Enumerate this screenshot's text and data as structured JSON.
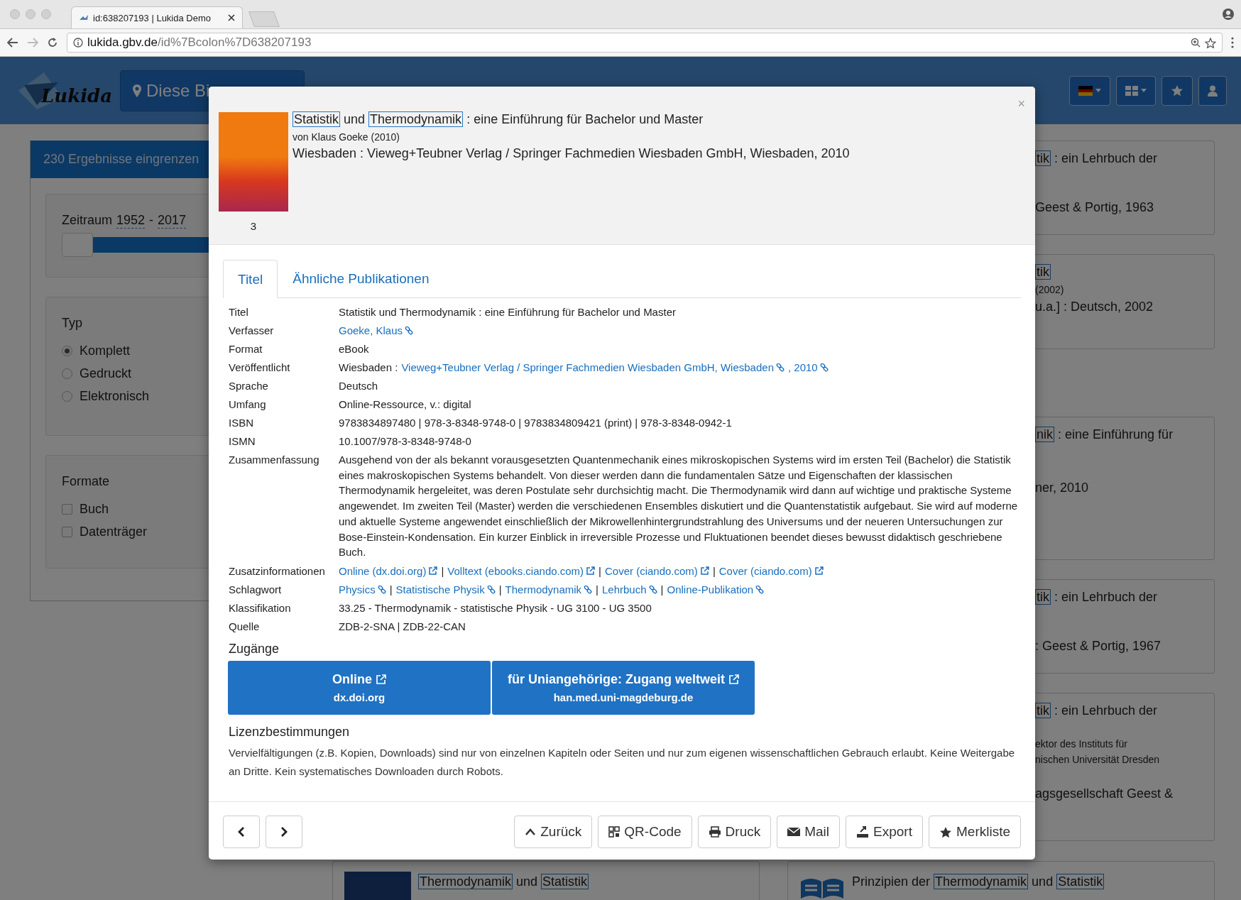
{
  "browser": {
    "tab_title": "id:638207193 | Lukida Demo",
    "url_host": "lukida.gbv.de",
    "url_path": "/id%7Bcolon%7D638207193"
  },
  "header": {
    "logo": "Lukida",
    "library_button": "Diese Bi"
  },
  "sidebar": {
    "title": "230 Ergebnisse eingrenzen",
    "period": {
      "label": "Zeitraum",
      "from": "1952",
      "separator": "-",
      "to": "2017",
      "level": 1
    },
    "type_group": {
      "label": "Typ",
      "options": [
        {
          "label": "Komplett",
          "selected": true
        },
        {
          "label": "Gedruckt",
          "selected": false
        },
        {
          "label": "Elektronisch",
          "selected": false
        }
      ]
    },
    "format_group": {
      "label": "Formate",
      "options": [
        {
          "label": "Buch",
          "checked": false
        },
        {
          "label": "Datenträger",
          "checked": false
        }
      ]
    }
  },
  "result_cards": [
    {
      "lines": [
        {
          "kind": "title",
          "parts": [
            {
              "text": "tik",
              "highlighted": true
            },
            {
              "text": " : ein Lehrbuch der",
              "highlighted": false
            }
          ]
        },
        {
          "kind": "publisher",
          "parts": [
            {
              "text": "Geest & Portig, 1963",
              "highlighted": false
            }
          ]
        }
      ]
    },
    {
      "lines": [
        {
          "kind": "title",
          "parts": [
            {
              "text": "tik",
              "highlighted": true
            }
          ]
        },
        {
          "kind": "author",
          "parts": [
            {
              "text": "(2002)",
              "highlighted": false
            }
          ]
        },
        {
          "kind": "meta",
          "parts": [
            {
              "text": "u.a.] : Deutsch, 2002",
              "highlighted": false
            }
          ]
        }
      ]
    },
    {
      "lines": [
        {
          "kind": "title",
          "parts": [
            {
              "text": "nik",
              "highlighted": true
            },
            {
              "text": " : eine Einführung für",
              "highlighted": false
            }
          ]
        },
        {
          "kind": "publisher",
          "parts": [
            {
              "text": "ner, 2010",
              "highlighted": false
            }
          ]
        }
      ]
    },
    {
      "lines": [
        {
          "kind": "title",
          "parts": [
            {
              "text": "tik",
              "highlighted": true
            },
            {
              "text": " : ein Lehrbuch der",
              "highlighted": false
            }
          ]
        },
        {
          "kind": "publisher",
          "parts": [
            {
              "text": ": Geest & Portig, 1967",
              "highlighted": false
            }
          ]
        }
      ]
    },
    {
      "lines": [
        {
          "kind": "title",
          "parts": [
            {
              "text": "tik",
              "highlighted": true
            },
            {
              "text": " : ein Lehrbuch der",
              "highlighted": false
            }
          ]
        },
        {
          "kind": "author",
          "parts": [
            {
              "text": "ektor des Instituts für",
              "highlighted": false
            }
          ]
        },
        {
          "kind": "author2",
          "parts": [
            {
              "text": "nischen Universität Dresden",
              "highlighted": false
            }
          ]
        },
        {
          "kind": "publisher",
          "parts": [
            {
              "text": "agsgesellschaft Geest &",
              "highlighted": false
            }
          ]
        }
      ]
    }
  ],
  "bottom_cards": [
    {
      "kind": "cover",
      "parts": [
        {
          "text": "Thermodynamik",
          "highlighted": true
        },
        {
          "text": " und ",
          "highlighted": false
        },
        {
          "text": "Statistik",
          "highlighted": true
        }
      ]
    },
    {
      "kind": "book",
      "parts": [
        {
          "text": "Prinzipien der ",
          "highlighted": false
        },
        {
          "text": "Thermodynamik",
          "highlighted": true
        },
        {
          "text": " und ",
          "highlighted": false
        },
        {
          "text": "Statistik",
          "highlighted": true
        }
      ]
    }
  ],
  "modal": {
    "close": "×",
    "cover_number": "3",
    "title_parts": [
      {
        "text": "Statistik",
        "highlighted": true
      },
      {
        "text": " und ",
        "highlighted": false
      },
      {
        "text": "Thermodynamik",
        "highlighted": true
      },
      {
        "text": " : eine Einführung für Bachelor und Master",
        "highlighted": false
      }
    ],
    "byline": "von Klaus Goeke (2010)",
    "imprint": "Wiesbaden : Vieweg+Teubner Verlag / Springer Fachmedien Wiesbaden GmbH, Wiesbaden, 2010",
    "tabs": [
      {
        "label": "Titel",
        "selected": true
      },
      {
        "label": "Ähnliche Publikationen",
        "selected": false
      }
    ],
    "details": [
      {
        "label": "Titel",
        "value": [
          {
            "kind": "text",
            "text": "Statistik und Thermodynamik : eine Einführung für Bachelor und Master"
          }
        ]
      },
      {
        "label": "Verfasser",
        "value": [
          {
            "kind": "search_link",
            "text": "Goeke, Klaus"
          }
        ]
      },
      {
        "label": "Format",
        "value": [
          {
            "kind": "text",
            "text": "eBook"
          }
        ]
      },
      {
        "label": "Veröffentlicht",
        "value": [
          {
            "kind": "text",
            "text": "Wiesbaden :"
          },
          {
            "kind": "search_link",
            "text": "Vieweg+Teubner Verlag / Springer Fachmedien Wiesbaden GmbH, Wiesbaden"
          },
          {
            "kind": "search_link",
            "text": ", 2010"
          }
        ]
      },
      {
        "label": "Sprache",
        "value": [
          {
            "kind": "text",
            "text": "Deutsch"
          }
        ]
      },
      {
        "label": "Umfang",
        "value": [
          {
            "kind": "text",
            "text": "Online-Ressource, v.: digital"
          }
        ]
      },
      {
        "label": "ISBN",
        "value": [
          {
            "kind": "text",
            "text": "9783834897480 | 978-3-8348-9748-0 | 9783834809421 (print) | 978-3-8348-0942-1"
          }
        ]
      },
      {
        "label": "ISMN",
        "value": [
          {
            "kind": "text",
            "text": "10.1007/978-3-8348-9748-0"
          }
        ]
      },
      {
        "label": "Zusammenfassung",
        "value": [
          {
            "kind": "paragraph",
            "text": "Ausgehend von der als bekannt vorausgesetzten Quantenmechanik eines mikroskopischen Systems wird im ersten Teil (Bachelor) die Statistik eines makroskopischen Systems behandelt. Von dieser werden dann die fundamentalen Sätze und Eigenschaften der klassischen Thermodynamik hergeleitet, was deren Postulate sehr durchsichtig macht. Die Thermodynamik wird dann auf wichtige und praktische Systeme angewendet. Im zweiten Teil (Master) werden die verschiedenen Ensembles diskutiert und die Quantenstatistik aufgebaut. Sie wird auf moderne und aktuelle Systeme angewendet einschließlich der Mikrowellenhintergrundstrahlung des Universums und der neueren Untersuchungen zur Bose-Einstein-Kondensation. Ein kurzer Einblick in irreversible Prozesse und Fluktuationen beendet dieses bewusst didaktisch geschriebene Buch."
          }
        ]
      },
      {
        "label": "Zusatzinformationen",
        "value": [
          {
            "kind": "external_link",
            "text": "Online (dx.doi.org)"
          },
          {
            "kind": "sep",
            "text": "|"
          },
          {
            "kind": "external_link",
            "text": "Volltext (ebooks.ciando.com)"
          },
          {
            "kind": "sep",
            "text": "|"
          },
          {
            "kind": "external_link",
            "text": "Cover (ciando.com)"
          },
          {
            "kind": "sep",
            "text": "|"
          },
          {
            "kind": "external_link",
            "text": "Cover (ciando.com)"
          }
        ]
      },
      {
        "label": "Schlagwort",
        "value": [
          {
            "kind": "search_link",
            "text": "Physics"
          },
          {
            "kind": "sep",
            "text": "|"
          },
          {
            "kind": "search_link",
            "text": "Statistische Physik"
          },
          {
            "kind": "sep",
            "text": "|"
          },
          {
            "kind": "search_link",
            "text": "Thermodynamik"
          },
          {
            "kind": "sep",
            "text": "|"
          },
          {
            "kind": "search_link",
            "text": "Lehrbuch"
          },
          {
            "kind": "sep",
            "text": "|"
          },
          {
            "kind": "search_link",
            "text": "Online-Publikation"
          }
        ]
      },
      {
        "label": "Klassifikation",
        "value": [
          {
            "kind": "text",
            "text": "33.25 - Thermodynamik - statistische Physik - UG 3100 - UG 3500"
          }
        ]
      },
      {
        "label": "Quelle",
        "value": [
          {
            "kind": "text",
            "text": "ZDB-2-SNA | ZDB-22-CAN"
          }
        ]
      }
    ],
    "access_heading": "Zugänge",
    "access_buttons": [
      {
        "label": "Online",
        "host": "dx.doi.org"
      },
      {
        "label": "für Uniangehörige: Zugang weltweit",
        "host": "han.med.uni-magdeburg.de"
      }
    ],
    "license_heading": "Lizenzbestimmungen",
    "license_text": "Vervielfältigungen (z.B. Kopien, Downloads) sind nur von einzelnen Kapiteln oder Seiten und nur zum eigenen wissenschaftlichen Gebrauch erlaubt. Keine Weitergabe an Dritte. Kein systematisches Downloaden durch Robots.",
    "footer_buttons": [
      {
        "kind": "back",
        "label": "Zurück"
      },
      {
        "kind": "qr",
        "label": "QR-Code"
      },
      {
        "kind": "print",
        "label": "Druck"
      },
      {
        "kind": "mail",
        "label": "Mail"
      },
      {
        "kind": "export",
        "label": "Export"
      },
      {
        "kind": "bookmark",
        "label": "Merkliste"
      }
    ]
  }
}
